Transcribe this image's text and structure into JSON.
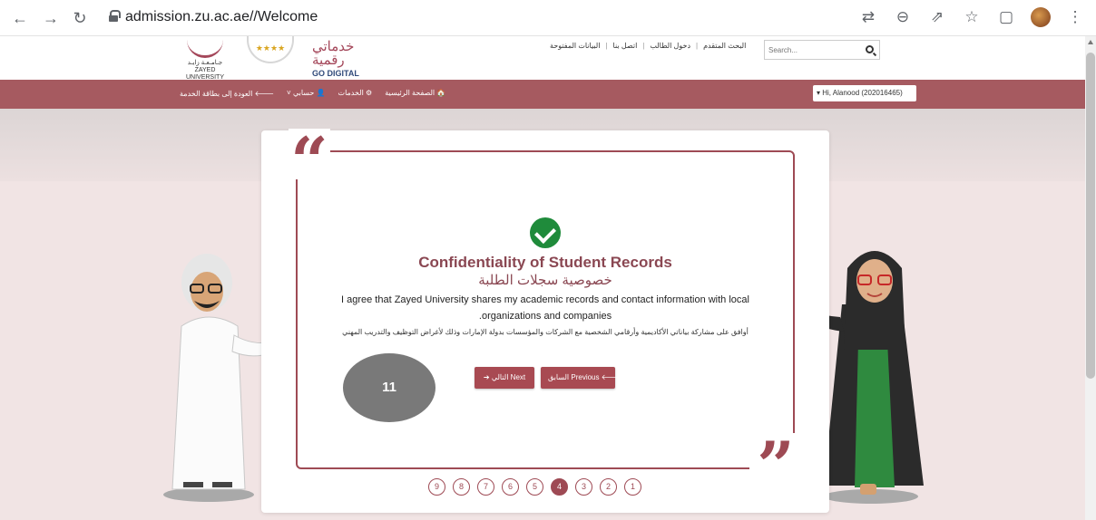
{
  "browser": {
    "url": "admission.zu.ac.ae//Welcome"
  },
  "header": {
    "university_name": "ZAYED UNIVERSITY",
    "university_name_ar": "جـامـعـة زايـد",
    "stars": "★★★★",
    "digital_ar": "خدماتي رقمية",
    "digital_en": "GO DIGITAL",
    "links": [
      "البحث المتقدم",
      "دخول الطالب",
      "اتصل بنا",
      "البيانات المفتوحة"
    ],
    "search_placeholder": "Search..."
  },
  "navbar": {
    "items": [
      "الصفحة الرئيسية",
      "الخدمات",
      "حسابي",
      "العودة إلى بطاقة الخدمة"
    ],
    "user_menu": "▾ Hi, Alanood (202016465)"
  },
  "card": {
    "title_en": "Confidentiality of Student Records",
    "title_ar": "خصوصية سجلات الطلبة",
    "body_en": "I agree that Zayed University shares my academic records and contact information with local .organizations and companies",
    "body_ar": "أوافق على مشاركة بياناتي الأكاديمية وأرقامي الشخصية مع الشركات والمؤسسات بدولة الإمارات وذلك لأغراض التوظيف والتدريب المهني",
    "next_label": "➔ التالي Next",
    "prev_label": "السابق Previous 🡐",
    "step_badge": "11"
  },
  "pager": {
    "pages": [
      "9",
      "8",
      "7",
      "6",
      "5",
      "4",
      "3",
      "2",
      "1"
    ],
    "active": "4"
  },
  "colors": {
    "brand": "#a65a60",
    "accent": "#9e4a54",
    "check": "#1f8b3b"
  }
}
